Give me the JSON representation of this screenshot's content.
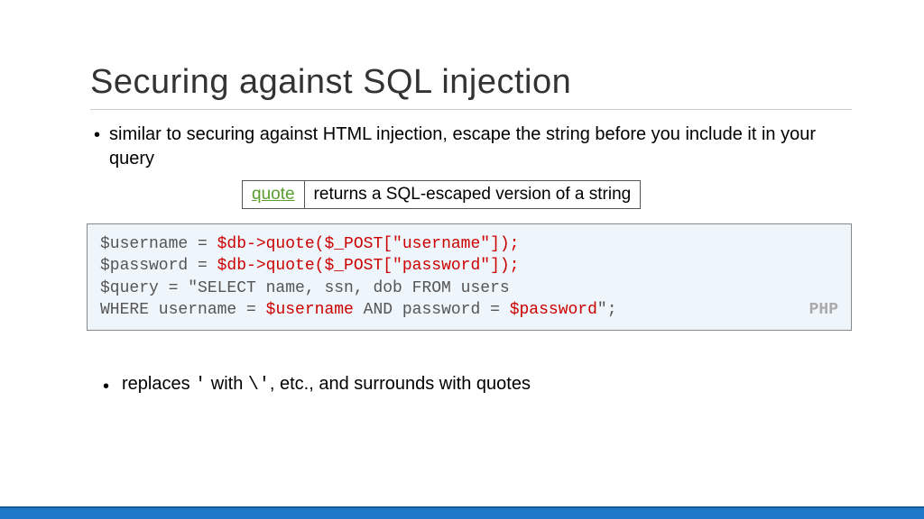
{
  "title": "Securing against SQL injection",
  "bullets": {
    "b1": "similar to securing against HTML injection, escape the string before you include it in your query",
    "b2_pre": "replaces ",
    "b2_q1": "'",
    "b2_mid": " with ",
    "b2_q2": "\\'",
    "b2_post": ", etc., and surrounds with quotes"
  },
  "table": {
    "func": "quote",
    "desc": "returns a SQL-escaped version of a string"
  },
  "code": {
    "l1a": "$username = ",
    "l1b": "$db->quote($_POST[\"username\"]);",
    "l2a": "$password = ",
    "l2b": "$db->quote($_POST[\"password\"]);",
    "l3": "$query = \"SELECT name, ssn, dob FROM users",
    "l4a": "WHERE username = ",
    "l4b": "$username",
    "l4c": " AND password = ",
    "l4d": "$password",
    "l4e": "\";",
    "lang": "PHP"
  }
}
